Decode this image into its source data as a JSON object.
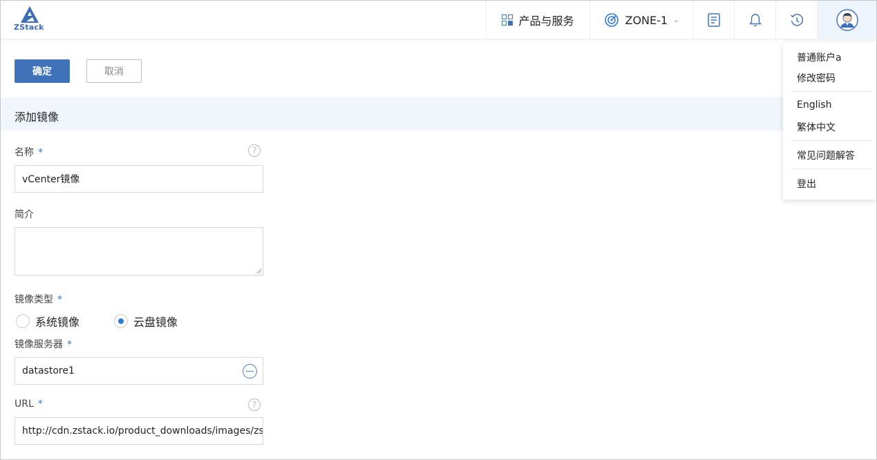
{
  "header": {
    "logo_text": "ZStack",
    "products_label": "产品与服务",
    "zone_label": "ZONE-1",
    "icons": [
      "grid-icon",
      "radar-icon",
      "chevron-down-icon",
      "document-icon",
      "bell-icon",
      "history-icon",
      "avatar-icon"
    ]
  },
  "user_menu": {
    "items": [
      "普通账户a",
      "修改密码",
      "English",
      "繁体中文",
      "常见问题解答",
      "登出"
    ]
  },
  "toolbar": {
    "confirm_label": "确定",
    "cancel_label": "取消"
  },
  "form": {
    "section_title": "添加镜像",
    "name_label": "名称",
    "name_value": "vCenter镜像",
    "desc_label": "简介",
    "desc_value": "",
    "image_type_label": "镜像类型",
    "image_type_options": [
      "系统镜像",
      "云盘镜像"
    ],
    "image_type_selected": "云盘镜像",
    "backup_storage_label": "镜像服务器",
    "backup_storage_value": "datastore1",
    "url_label": "URL",
    "url_value": "http://cdn.zstack.io/product_downloads/images/zstac",
    "required_mark": "*",
    "help_mark": "?"
  },
  "colors": {
    "primary": "#3f72b9",
    "section_bg": "#f0f6fc",
    "radio_selected": "#2e7bd9"
  }
}
